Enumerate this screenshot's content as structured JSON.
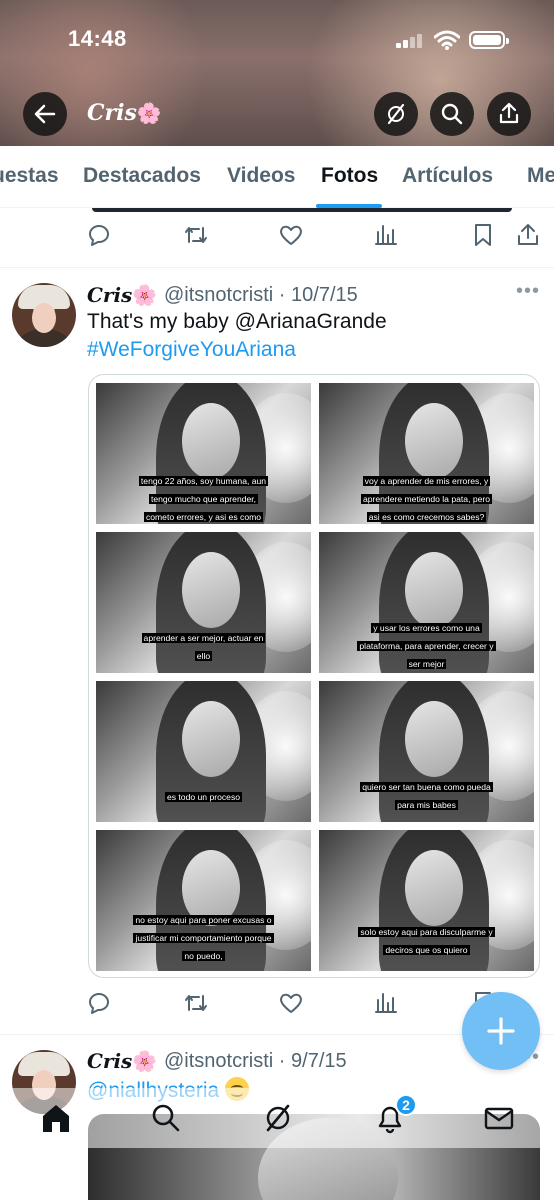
{
  "status_bar": {
    "time": "14:48"
  },
  "header": {
    "title": "Cris",
    "title_emoji": "🌸"
  },
  "tabs": [
    "uestas",
    "Destacados",
    "Videos",
    "Fotos",
    "Artículos",
    "Me"
  ],
  "active_tab": "Fotos",
  "tweets": [
    {
      "name": "Cris",
      "name_emoji": "🌸",
      "handle": "@itsnotcristi",
      "date": "10/7/15",
      "text_line1": "That's my baby @ArianaGrande",
      "hashtag": "#WeForgiveYouAriana",
      "captions": [
        "tengo 22 años, soy humana, aun tengo mucho que aprender, cometo errores, y asi es como aprendere",
        "voy a aprender de mis errores, y aprendere metiendo la pata, pero asi es como crecemos sabes?",
        "aprender a ser mejor, actuar en ello",
        "y usar los errores como una plataforma, para aprender, crecer y ser mejor",
        "es todo un proceso",
        "quiero ser tan buena como pueda para mis babes",
        "no estoy aqui para poner excusas o justificar mi comportamiento porque no puedo,",
        "solo estoy aqui para disculparme y deciros que os quiero"
      ]
    },
    {
      "name": "Cris",
      "name_emoji": "🌸",
      "handle": "@itsnotcristi",
      "date": "9/7/15",
      "text_line1": "@niallhysteria"
    }
  ],
  "notifications_badge": "2",
  "icons": {
    "header": [
      "back-arrow-icon",
      "mute-icon",
      "search-icon",
      "share-icon"
    ],
    "actions": [
      "reply-icon",
      "retweet-icon",
      "like-icon",
      "views-icon",
      "bookmark-icon",
      "share-icon"
    ],
    "nav": [
      "home-icon",
      "search-icon",
      "grok-icon",
      "bell-icon",
      "mail-icon"
    ]
  },
  "colors": {
    "accent": "#1d9bf0",
    "fab": "#72bff5",
    "secondary_text": "#536471"
  }
}
